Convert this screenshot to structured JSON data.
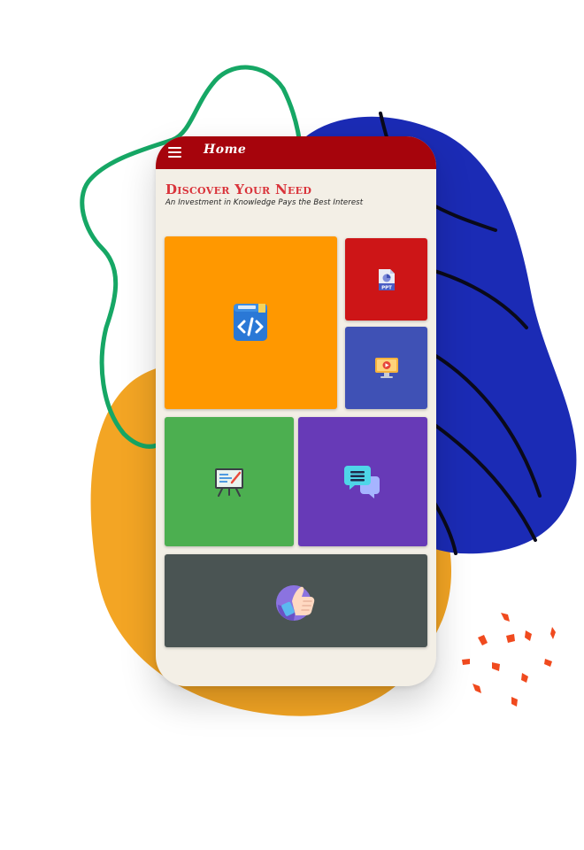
{
  "appbar": {
    "title": "Home",
    "color": "#a6040c"
  },
  "header": {
    "title": "Discover Your Need",
    "subtitle": "An Investment in Knowledge Pays the Best Interest"
  },
  "tiles": [
    {
      "icon": "code-book-icon",
      "color": "#ff9800"
    },
    {
      "icon": "ppt-file-icon",
      "color": "#cd1517"
    },
    {
      "icon": "video-monitor-icon",
      "color": "#3f51b5"
    },
    {
      "icon": "presentation-board-icon",
      "color": "#4caf50"
    },
    {
      "icon": "chat-bubbles-icon",
      "color": "#673ab7"
    },
    {
      "icon": "thumbs-up-icon",
      "color": "#4a5453"
    }
  ],
  "ppt_icon_label": "PPT"
}
